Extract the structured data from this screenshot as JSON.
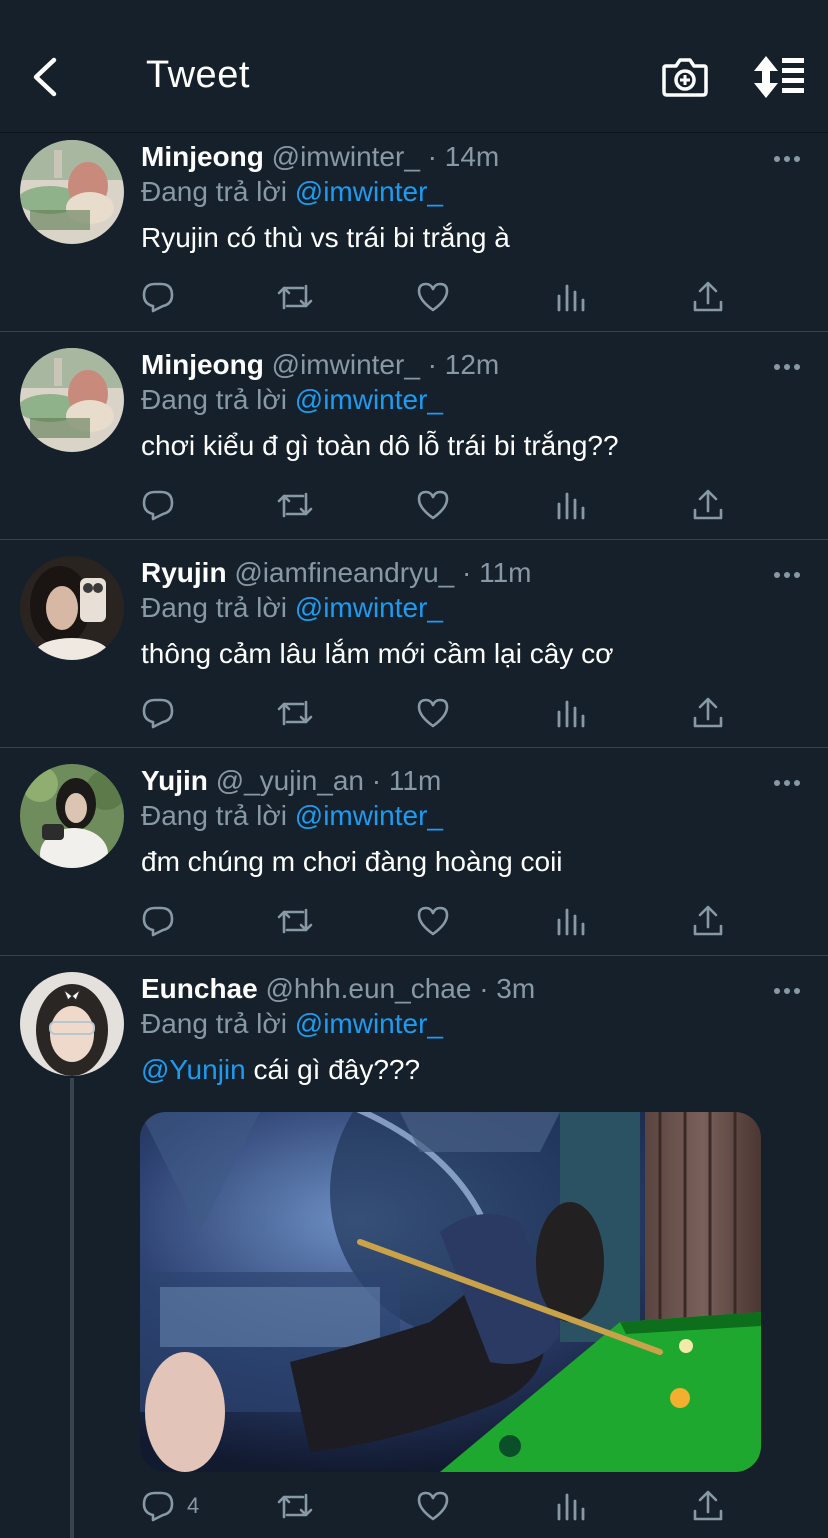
{
  "header": {
    "title": "Tweet",
    "back_icon": "chevron-left-icon",
    "camera_icon": "camera-plus-icon",
    "sort_icon": "sort-list-icon"
  },
  "tweets": [
    {
      "name": "Minjeong",
      "handle": "@imwinter_",
      "time": "· 14m",
      "replying_prefix": "Đang trả lời",
      "replying_to": "@imwinter_",
      "text": "Ryujin có thù vs trái bi trắng à",
      "reply_count": ""
    },
    {
      "name": "Minjeong",
      "handle": "@imwinter_",
      "time": "· 12m",
      "replying_prefix": "Đang trả lời",
      "replying_to": "@imwinter_",
      "text": "chơi kiểu đ gì toàn dô lỗ trái bi trắng??",
      "reply_count": ""
    },
    {
      "name": "Ryujin",
      "handle": "@iamfineandryu_",
      "time": "· 11m",
      "replying_prefix": "Đang trả lời",
      "replying_to": "@imwinter_",
      "text": "thông cảm lâu lắm mới cầm lại cây cơ",
      "reply_count": ""
    },
    {
      "name": "Yujin",
      "handle": "@_yujin_an",
      "time": "· 11m",
      "replying_prefix": "Đang trả lời",
      "replying_to": "@imwinter_",
      "text": "đm chúng m chơi đàng hoàng coii",
      "reply_count": ""
    },
    {
      "name": "Eunchae",
      "handle": "@hhh.eun_chae",
      "time": "· 3m",
      "replying_prefix": "Đang trả lời",
      "replying_to": "@imwinter_",
      "text_mention": "@Yunjin",
      "text": " cái gì đây???",
      "reply_count": "4"
    }
  ],
  "action_icons": [
    "reply-icon",
    "retweet-icon",
    "like-icon",
    "analytics-icon",
    "share-icon"
  ],
  "colors": {
    "background": "#15202b",
    "text": "#ffffff",
    "secondary": "#8899a6",
    "accent": "#1d9bf0",
    "divider": "#38444d"
  }
}
